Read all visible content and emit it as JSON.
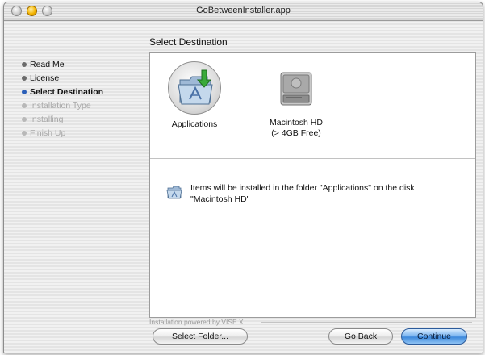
{
  "window": {
    "title": "GoBetweenInstaller.app"
  },
  "heading": "Select Destination",
  "steps": [
    {
      "label": "Read Me",
      "state": "done"
    },
    {
      "label": "License",
      "state": "done"
    },
    {
      "label": "Select Destination",
      "state": "active"
    },
    {
      "label": "Installation Type",
      "state": "pending"
    },
    {
      "label": "Installing",
      "state": "pending"
    },
    {
      "label": "Finish Up",
      "state": "pending"
    }
  ],
  "destinations": [
    {
      "name": "Applications",
      "icon": "applications-folder-icon",
      "selected": true
    },
    {
      "name": "Macintosh HD",
      "detail": "(> 4GB Free)",
      "icon": "hard-disk-icon",
      "selected": false
    }
  ],
  "info": {
    "icon": "applications-folder-icon",
    "text": "Items will be installed in the folder \"Applications\" on the disk \"Macintosh HD\""
  },
  "footer": {
    "powered_by": "Installation powered by VISE X"
  },
  "buttons": {
    "select_folder": "Select Folder...",
    "go_back": "Go Back",
    "continue": "Continue"
  },
  "colors": {
    "active_bullet": "#2b5fb8",
    "pending_text": "#a8a8a8",
    "default_button": "#3c88db"
  }
}
